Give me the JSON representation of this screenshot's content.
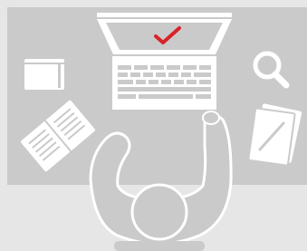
{
  "illustration": {
    "subject": "person-at-desk-top-view",
    "icons": [
      "laptop-icon",
      "checkmark-icon",
      "notebook-icon",
      "open-book-icon",
      "magnifier-icon",
      "documents-pen-icon",
      "person-icon"
    ],
    "colors": {
      "page_background": "#e6e6e6",
      "desk": "#cacaca",
      "objects": "#ffffff",
      "person": "#cacaca",
      "accent_check": "#d8232a"
    }
  }
}
